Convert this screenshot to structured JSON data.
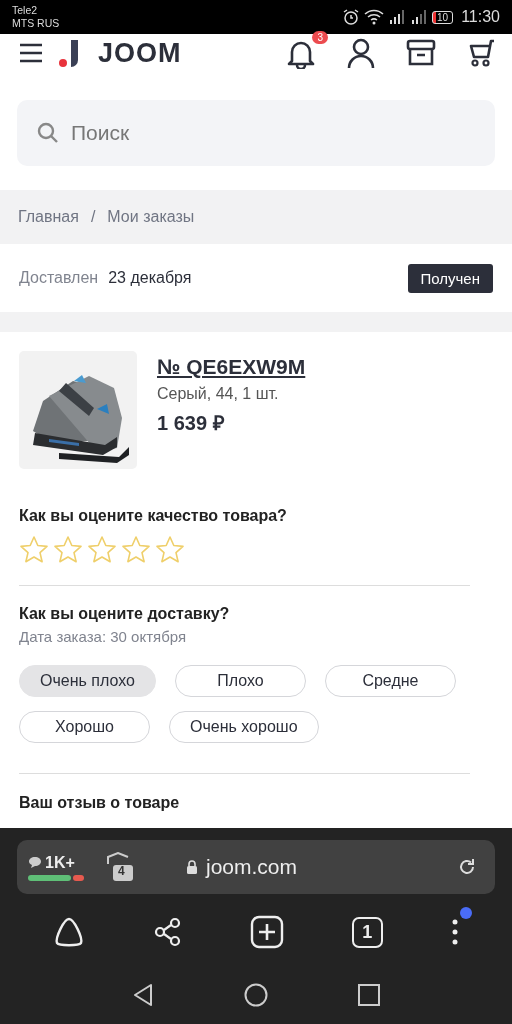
{
  "status_bar": {
    "carriers": [
      "Tele2",
      "MTS RUS"
    ],
    "battery": "10",
    "time": "11:30"
  },
  "header": {
    "logo": "JOOM",
    "notifications_badge": "3"
  },
  "search": {
    "placeholder": "Поиск"
  },
  "breadcrumbs": [
    "Главная",
    "/",
    "Мои заказы"
  ],
  "delivery": {
    "label": "Доставлен",
    "date": "23 декабря",
    "status": "Получен"
  },
  "order": {
    "number": "№ QE6EXW9M",
    "details": "Серый, 44, 1 шт.",
    "price": "1 639 ₽"
  },
  "quality": {
    "question": "Как вы оцените качество товара?",
    "stars": 0
  },
  "delivery_rating": {
    "question": "Как вы оцените доставку?",
    "order_date": "Дата заказа: 30 октября",
    "options": [
      {
        "label": "Очень плохо",
        "selected": true
      },
      {
        "label": "Плохо",
        "selected": false
      },
      {
        "label": "Средне",
        "selected": false
      },
      {
        "label": "Хорошо",
        "selected": false
      },
      {
        "label": "Очень хорошо",
        "selected": false
      }
    ]
  },
  "review": {
    "title": "Ваш отзыв о товаре"
  },
  "browser": {
    "comments": "1K+",
    "shield_count": "4",
    "url": "joom.com",
    "tabs_count": "1"
  }
}
